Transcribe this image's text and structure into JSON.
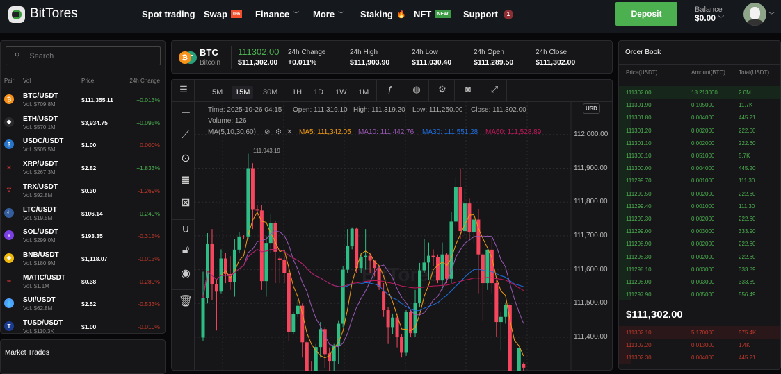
{
  "nav": {
    "brand": "BitTores",
    "items": [
      {
        "label": "Spot trading"
      },
      {
        "label": "Swap",
        "badge": "0%"
      },
      {
        "label": "Finance"
      },
      {
        "label": "More"
      },
      {
        "label": "Staking"
      },
      {
        "label": "NFT",
        "badge": "NEW"
      },
      {
        "label": "Support",
        "badge": "1"
      }
    ],
    "deposit": "Deposit",
    "balance_label": "Balance",
    "balance_value": "$0.00"
  },
  "pairs": {
    "search_placeholder": "Search",
    "headers": [
      "Pair",
      "Vol",
      "Price",
      "24h Change"
    ],
    "rows": [
      {
        "name": "BTC/USDT",
        "vol": "Vol. $709.8M",
        "price": "$111,355.11",
        "change": "+0.013%",
        "dir": "up",
        "icon": "bitcoin-icon",
        "color": "#f7931a",
        "glyph": "₿"
      },
      {
        "name": "ETH/USDT",
        "vol": "Vol. $570.1M",
        "price": "$3,934.75",
        "change": "+0.095%",
        "dir": "up",
        "icon": "ethereum-icon",
        "color": "#2a2a2e",
        "glyph": "◆"
      },
      {
        "name": "USDC/USDT",
        "vol": "Vol. $505.5M",
        "price": "$1.00",
        "change": "0.000%",
        "dir": "down",
        "icon": "usdc-icon",
        "color": "#2775ca",
        "glyph": "$"
      },
      {
        "name": "XRP/USDT",
        "vol": "Vol. $267.3M",
        "price": "$2.82",
        "change": "+1.833%",
        "dir": "up",
        "icon": "xrp-icon",
        "color": "#161618",
        "glyph": "✕"
      },
      {
        "name": "TRX/USDT",
        "vol": "Vol. $92.8M",
        "price": "$0.30",
        "change": "-1.269%",
        "dir": "down",
        "icon": "tron-icon",
        "color": "#161618",
        "glyph": "▽"
      },
      {
        "name": "LTC/USDT",
        "vol": "Vol. $19.5M",
        "price": "$106.14",
        "change": "+0.249%",
        "dir": "up",
        "icon": "litecoin-icon",
        "color": "#345d9d",
        "glyph": "Ł"
      },
      {
        "name": "SOL/USDT",
        "vol": "Vol. $299.0M",
        "price": "$193.35",
        "change": "-0.315%",
        "dir": "down",
        "icon": "solana-icon",
        "color": "#7b3fe4",
        "glyph": "≡"
      },
      {
        "name": "BNB/USDT",
        "vol": "Vol. $180.9M",
        "price": "$1,118.07",
        "change": "-0.013%",
        "dir": "down",
        "icon": "bnb-icon",
        "color": "#f0b90b",
        "glyph": "◈"
      },
      {
        "name": "MATIC/USDT",
        "vol": "Vol. $1.1M",
        "price": "$0.38",
        "change": "-0.289%",
        "dir": "down",
        "icon": "polygon-icon",
        "color": "#161618",
        "glyph": "∞"
      },
      {
        "name": "SUI/USDT",
        "vol": "Vol. $62.8M",
        "price": "$2.52",
        "change": "-0.533%",
        "dir": "down",
        "icon": "sui-icon",
        "color": "#4da2ff",
        "glyph": "💧"
      },
      {
        "name": "TUSD/USDT",
        "vol": "Vol. $110.3K",
        "price": "$1.00",
        "change": "-0.010%",
        "dir": "down",
        "icon": "tusd-icon",
        "color": "#1a3b8f",
        "glyph": "T"
      }
    ]
  },
  "market_trades": {
    "title": "Market Trades"
  },
  "ticker": {
    "symbol": "BTC",
    "name": "Bitcoin",
    "last": "111302.00",
    "last_usd": "$111,302.00",
    "stats": [
      {
        "label": "24h Change",
        "value": "+0.011%"
      },
      {
        "label": "24h High",
        "value": "$111,903.90"
      },
      {
        "label": "24h Low",
        "value": "$111,030.40"
      },
      {
        "label": "24h Open",
        "value": "$111,289.50"
      },
      {
        "label": "24h Close",
        "value": "$111,302.00"
      }
    ]
  },
  "chart": {
    "timeframes": [
      "5M",
      "15M",
      "30M",
      "1H",
      "1D",
      "1W",
      "1M"
    ],
    "active_timeframe": "15M",
    "currency": "USD",
    "info": {
      "time": "Time: 2025-10-26 04:15",
      "open": "Open: 111,319.10",
      "high": "High: 111,319.20",
      "low": "Low: 111,250.00",
      "close": "Close: 111,302.00",
      "volume": "Volume: 126",
      "ma_label": "MA(5,10,30,60)",
      "ma5": "MA5: 111,342.05",
      "ma10": "MA10: 111,442.76",
      "ma30": "MA30: 111,551.28",
      "ma60": "MA60: 111,528.89"
    },
    "max_label": "111,943.19",
    "watermark": "BitTores",
    "colors": {
      "up": "#2ebd85",
      "down": "#f6465d",
      "ma5": "#f39c12",
      "ma10": "#9b59b6",
      "ma30": "#1e6fe0",
      "ma60": "#c2185b"
    }
  },
  "chart_data": {
    "type": "candlestick",
    "title": "BTC/USDT 15M",
    "y_ticks": [
      "112,000.00",
      "111,900.00",
      "111,800.00",
      "111,700.00",
      "111,600.00",
      "111,500.00",
      "111,400.00"
    ],
    "y_tick_values": [
      112000,
      111900,
      111800,
      111700,
      111600,
      111500,
      111400
    ],
    "ylim": [
      111315,
      112080
    ],
    "ohlc": [
      [
        111399,
        111594,
        111390,
        111515
      ],
      [
        111515,
        111708,
        111500,
        111676
      ],
      [
        111676,
        111720,
        111510,
        111556
      ],
      [
        111556,
        111570,
        111420,
        111535
      ],
      [
        111535,
        111660,
        111530,
        111633
      ],
      [
        111633,
        111650,
        111560,
        111587
      ],
      [
        111587,
        111640,
        111540,
        111563
      ],
      [
        111563,
        111690,
        111520,
        111659
      ],
      [
        111659,
        111710,
        111650,
        111698
      ],
      [
        111698,
        111702,
        111690,
        111697
      ],
      [
        111698,
        111943,
        111690,
        111900
      ],
      [
        111900,
        111915,
        111720,
        111779
      ],
      [
        111779,
        111790,
        111760,
        111775
      ],
      [
        111775,
        111790,
        111540,
        111566
      ],
      [
        111566,
        111700,
        111520,
        111679
      ],
      [
        111679,
        111764,
        111650,
        111738
      ],
      [
        111738,
        111745,
        111560,
        111653
      ],
      [
        111633,
        111640,
        111560,
        111630
      ],
      [
        111630,
        111640,
        111560,
        111590
      ],
      [
        111590,
        111615,
        111390,
        111416
      ],
      [
        111416,
        111475,
        111410,
        111469
      ],
      [
        111469,
        111510,
        111460,
        111493
      ],
      [
        111493,
        111500,
        111340,
        111385
      ],
      [
        111385,
        111390,
        111280,
        111300
      ],
      [
        111300,
        111330,
        111220,
        111250
      ],
      [
        111270,
        111380,
        111250,
        111371
      ],
      [
        111371,
        111445,
        111340,
        111424
      ],
      [
        111424,
        111430,
        111310,
        111350
      ],
      [
        111352,
        111370,
        111300,
        111330
      ],
      [
        111330,
        111380,
        111300,
        111374
      ],
      [
        111374,
        111450,
        111320,
        111440
      ],
      [
        111440,
        111610,
        111430,
        111600
      ],
      [
        111600,
        111720,
        111590,
        111669
      ],
      [
        111669,
        111725,
        111660,
        111721
      ],
      [
        111721,
        111725,
        111590,
        111605
      ],
      [
        111605,
        111650,
        111590,
        111638
      ],
      [
        111638,
        111720,
        111600,
        111641
      ],
      [
        111641,
        111650,
        111590,
        111627
      ],
      [
        111627,
        111610,
        111580,
        111605
      ],
      [
        111605,
        111610,
        111540,
        111550
      ],
      [
        111535,
        111560,
        111460,
        111480
      ],
      [
        111480,
        111490,
        111380,
        111430
      ],
      [
        111430,
        111470,
        111410,
        111458
      ],
      [
        111458,
        111470,
        111370,
        111400
      ],
      [
        111400,
        111410,
        111340,
        111354
      ],
      [
        111354,
        111480,
        111345,
        111475
      ],
      [
        111475,
        111480,
        111400,
        111412
      ],
      [
        111412,
        111540,
        111400,
        111502
      ],
      [
        111502,
        111620,
        111490,
        111598
      ],
      [
        111598,
        111690,
        111590,
        111621
      ],
      [
        111621,
        111680,
        111570,
        111641
      ],
      [
        111641,
        111660,
        111610,
        111638
      ],
      [
        111638,
        111645,
        111560,
        111568
      ],
      [
        111568,
        111680,
        111540,
        111645
      ],
      [
        111645,
        111650,
        111560,
        111573
      ],
      [
        111573,
        111770,
        111560,
        111742
      ],
      [
        111742,
        111874,
        111730,
        111844
      ],
      [
        111844,
        111900,
        111690,
        111714
      ],
      [
        111714,
        111840,
        111700,
        111796
      ],
      [
        111796,
        111810,
        111690,
        111710
      ],
      [
        111710,
        111770,
        111680,
        111748
      ],
      [
        111748,
        111780,
        111530,
        111645
      ],
      [
        111645,
        111650,
        111450,
        111560
      ],
      [
        111560,
        111660,
        111540,
        111659
      ],
      [
        111659,
        111690,
        111530,
        111560
      ],
      [
        111560,
        111570,
        111400,
        111445
      ],
      [
        111445,
        111475,
        111360,
        111460
      ],
      [
        111460,
        111500,
        111440,
        111495
      ],
      [
        111495,
        111500,
        111260,
        111290
      ],
      [
        111290,
        111300,
        111240,
        111260
      ],
      [
        111280,
        111370,
        111270,
        111368
      ],
      [
        111320,
        111325,
        111300,
        111310
      ]
    ],
    "ma_periods": [
      5,
      10,
      30,
      60
    ]
  },
  "order_book": {
    "title": "Order Book",
    "headers": [
      "Price(USDT)",
      "Amount(BTC)",
      "Total(USDT)"
    ],
    "bids": [
      [
        "111302.00",
        "18.213000",
        "2.0M"
      ],
      [
        "111301.90",
        "0.105000",
        "11.7K"
      ],
      [
        "111301.80",
        "0.004000",
        "445.21"
      ],
      [
        "111301.20",
        "0.002000",
        "222.60"
      ],
      [
        "111301.10",
        "0.002000",
        "222.60"
      ],
      [
        "111300.10",
        "0.051000",
        "5.7K"
      ],
      [
        "111300.00",
        "0.004000",
        "445.20"
      ],
      [
        "111299.70",
        "0.001000",
        "111.30"
      ],
      [
        "111299.50",
        "0.002000",
        "222.60"
      ],
      [
        "111299.40",
        "0.001000",
        "111.30"
      ],
      [
        "111299.30",
        "0.002000",
        "222.60"
      ],
      [
        "111299.00",
        "0.003000",
        "333.90"
      ],
      [
        "111298.90",
        "0.002000",
        "222.60"
      ],
      [
        "111298.30",
        "0.002000",
        "222.60"
      ],
      [
        "111298.10",
        "0.003000",
        "333.89"
      ],
      [
        "111298.00",
        "0.003000",
        "333.89"
      ],
      [
        "111297.90",
        "0.005000",
        "556.49"
      ]
    ],
    "mid_price": "$111,302.00",
    "asks": [
      [
        "111302.10",
        "5.170000",
        "575.4K"
      ],
      [
        "111302.20",
        "0.013000",
        "1.4K"
      ],
      [
        "111302.30",
        "0.004000",
        "445.21"
      ]
    ]
  }
}
